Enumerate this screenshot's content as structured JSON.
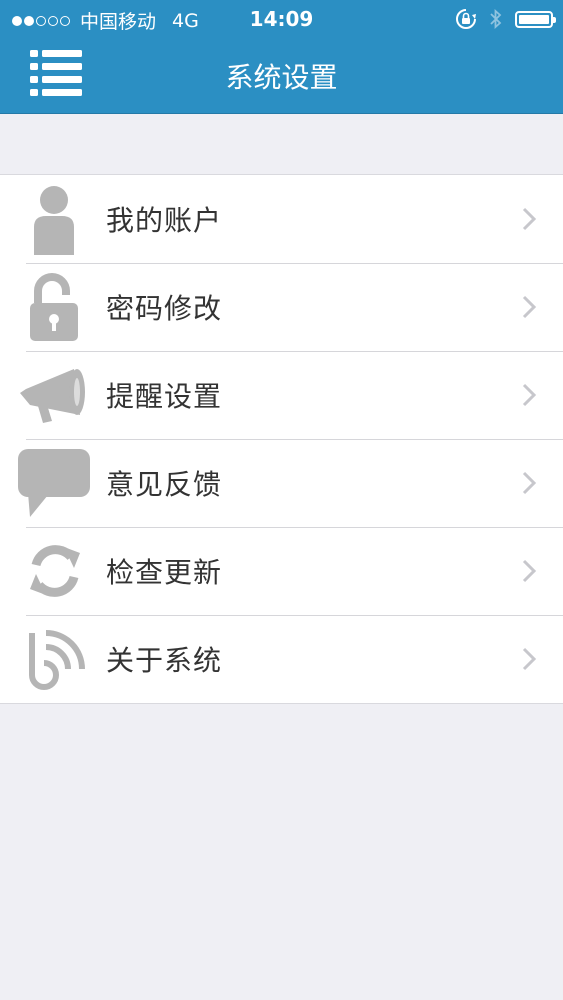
{
  "status_bar": {
    "carrier": "中国移动",
    "network": "4G",
    "time": "14:09"
  },
  "navbar": {
    "title": "系统设置",
    "menu_icon": "list-menu-icon",
    "background_color": "#2b8fc3"
  },
  "menu": {
    "items": [
      {
        "label": "我的账户",
        "icon": "user-icon"
      },
      {
        "label": "密码修改",
        "icon": "unlock-icon"
      },
      {
        "label": "提醒设置",
        "icon": "megaphone-icon"
      },
      {
        "label": "意见反馈",
        "icon": "speech-bubble-icon"
      },
      {
        "label": "检查更新",
        "icon": "refresh-icon"
      },
      {
        "label": "关于系统",
        "icon": "about-logo-icon"
      }
    ]
  },
  "colors": {
    "icon_gray": "#b5b5b5",
    "chevron_gray": "#c7c7cc",
    "page_background": "#efeff4"
  }
}
